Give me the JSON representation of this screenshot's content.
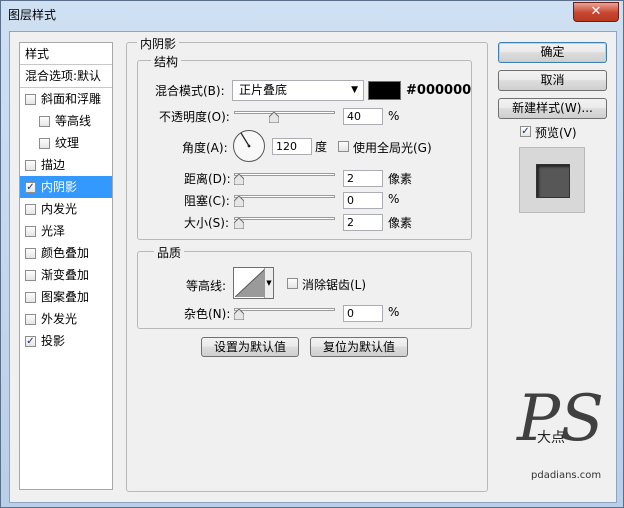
{
  "window": {
    "title": "图层样式",
    "close_glyph": "✕"
  },
  "left_list": {
    "header": "样式",
    "blend_options": "混合选项:默认",
    "items": [
      {
        "label": "斜面和浮雕",
        "checked": false
      },
      {
        "label": "等高线",
        "checked": false
      },
      {
        "label": "纹理",
        "checked": false
      },
      {
        "label": "描边",
        "checked": false
      },
      {
        "label": "内阴影",
        "checked": true,
        "selected": true
      },
      {
        "label": "内发光",
        "checked": false
      },
      {
        "label": "光泽",
        "checked": false
      },
      {
        "label": "颜色叠加",
        "checked": false
      },
      {
        "label": "渐变叠加",
        "checked": false
      },
      {
        "label": "图案叠加",
        "checked": false
      },
      {
        "label": "外发光",
        "checked": false
      },
      {
        "label": "投影",
        "checked": true
      }
    ]
  },
  "panel": {
    "title": "内阴影",
    "structure": {
      "title": "结构",
      "blend_mode_label": "混合模式(B):",
      "blend_mode_value": "正片叠底",
      "color_hex": "#000000",
      "color": "#000000",
      "opacity_label": "不透明度(O):",
      "opacity_value": "40",
      "opacity_unit": "%",
      "angle_label": "角度(A):",
      "angle_value": "120",
      "angle_unit": "度",
      "global_light_label": "使用全局光(G)",
      "global_light_checked": false,
      "distance_label": "距离(D):",
      "distance_value": "2",
      "distance_unit": "像素",
      "choke_label": "阻塞(C):",
      "choke_value": "0",
      "choke_unit": "%",
      "size_label": "大小(S):",
      "size_value": "2",
      "size_unit": "像素"
    },
    "quality": {
      "title": "品质",
      "contour_label": "等高线:",
      "anti_alias_label": "消除锯齿(L)",
      "anti_alias_checked": false,
      "noise_label": "杂色(N):",
      "noise_value": "0",
      "noise_unit": "%"
    },
    "set_default_button": "设置为默认值",
    "reset_default_button": "复位为默认值"
  },
  "right": {
    "ok_button": "确定",
    "cancel_button": "取消",
    "new_style_button": "新建样式(W)...",
    "preview_label": "预览(V)",
    "preview_checked": true
  },
  "watermark": {
    "logo": "PS",
    "logo_small": "大点",
    "site": "pdadians.com"
  }
}
